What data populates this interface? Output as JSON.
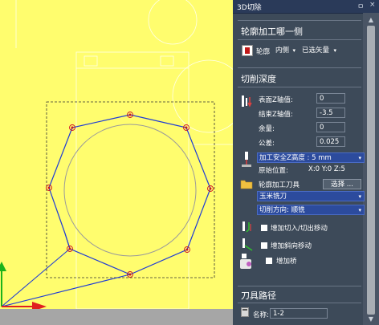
{
  "panel": {
    "title": "3D切除",
    "pin_glyph": "ㅁ",
    "close_glyph": "×"
  },
  "profile_side": {
    "heading": "轮廓加工哪一侧",
    "profile_label": "轮廓",
    "side_select": "内侧",
    "vector_select": "已选矢量"
  },
  "cut_depth": {
    "heading": "切削深度",
    "surface_z_label": "表面Z轴值:",
    "surface_z_value": "0",
    "end_z_label": "结束Z轴值:",
    "end_z_value": "-3.5",
    "allowance_label": "余量:",
    "allowance_value": "0",
    "tolerance_label": "公差:",
    "tolerance_value": "0.025",
    "safe_z_select": "加工安全Z高度 : 5 mm",
    "origin_label": "原始位置:",
    "origin_value": "X:0 Y:0 Z:5"
  },
  "tool": {
    "label": "轮廓加工刀具",
    "select_button": "选择 ...",
    "tool_select": "玉米铣刀",
    "direction_select": "切削方向: 顺铣",
    "leadin_label": "增加切入/切出移动",
    "ramp_label": "增加斜向移动",
    "bridge_label": "增加桥"
  },
  "toolpath": {
    "heading": "刀具路径",
    "name_label": "名称:",
    "name_value": "1-2"
  },
  "colors": {
    "canvas_bg": "#fffd6e",
    "panel_bg": "#3d4a59",
    "toolpath_blue": "#1e3bd6",
    "marker_red": "#d01020",
    "highlight_blue": "#2c4b9d"
  }
}
